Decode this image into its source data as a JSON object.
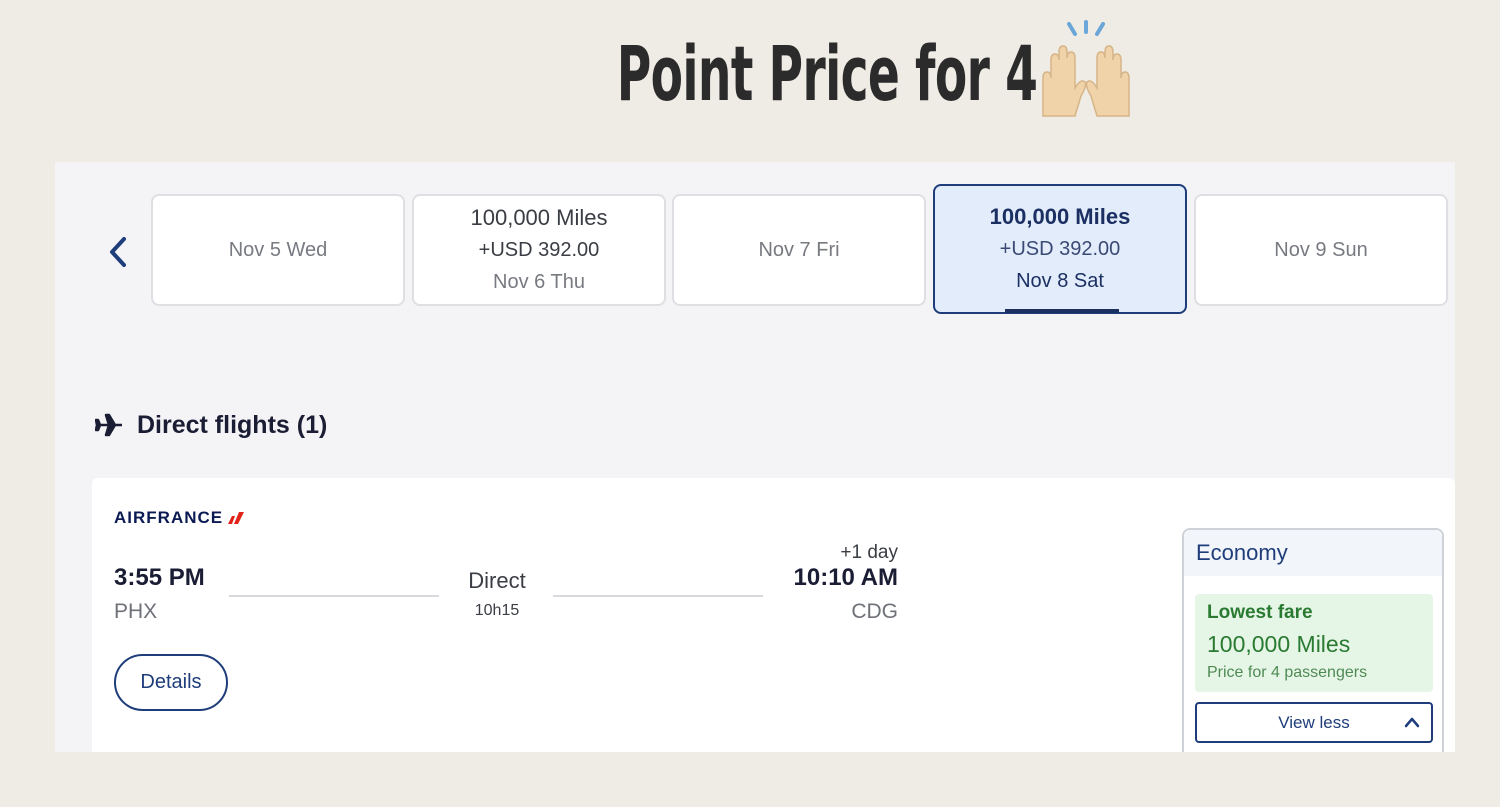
{
  "headline": {
    "text": "Point Price for 4",
    "emoji": "raising-hands"
  },
  "date_nav": {
    "prev_icon": "chevron-left-icon",
    "cards": [
      {
        "miles": "",
        "usd": "",
        "day": "Nov 5 Wed",
        "selected": false
      },
      {
        "miles": "100,000 Miles",
        "usd": "+USD 392.00",
        "day": "Nov 6 Thu",
        "selected": false
      },
      {
        "miles": "",
        "usd": "",
        "day": "Nov 7 Fri",
        "selected": false
      },
      {
        "miles": "100,000 Miles",
        "usd": "+USD 392.00",
        "day": "Nov 8 Sat",
        "selected": true
      },
      {
        "miles": "",
        "usd": "",
        "day": "Nov 9 Sun",
        "selected": false
      }
    ]
  },
  "section": {
    "icon": "airplane-icon",
    "title": "Direct flights (1)"
  },
  "flight": {
    "airline": "AIRFRANCE",
    "departure_time": "3:55 PM",
    "departure_airport": "PHX",
    "stops": "Direct",
    "duration": "10h15",
    "day_offset": "+1 day",
    "arrival_time": "10:10 AM",
    "arrival_airport": "CDG",
    "details_label": "Details"
  },
  "fare": {
    "cabin": "Economy",
    "badge": "Lowest fare",
    "miles": "100,000 Miles",
    "note": "Price for 4 passengers",
    "toggle_label": "View less",
    "toggle_icon": "chevron-up-icon"
  },
  "colors": {
    "page_bg": "#efebe5",
    "brand_navy": "#1e3d7a",
    "selected_bg": "#e3ecfa",
    "fare_green": "#2a7a32",
    "fare_green_bg": "#e6f6e6",
    "airfrance_red": "#e2231a"
  }
}
